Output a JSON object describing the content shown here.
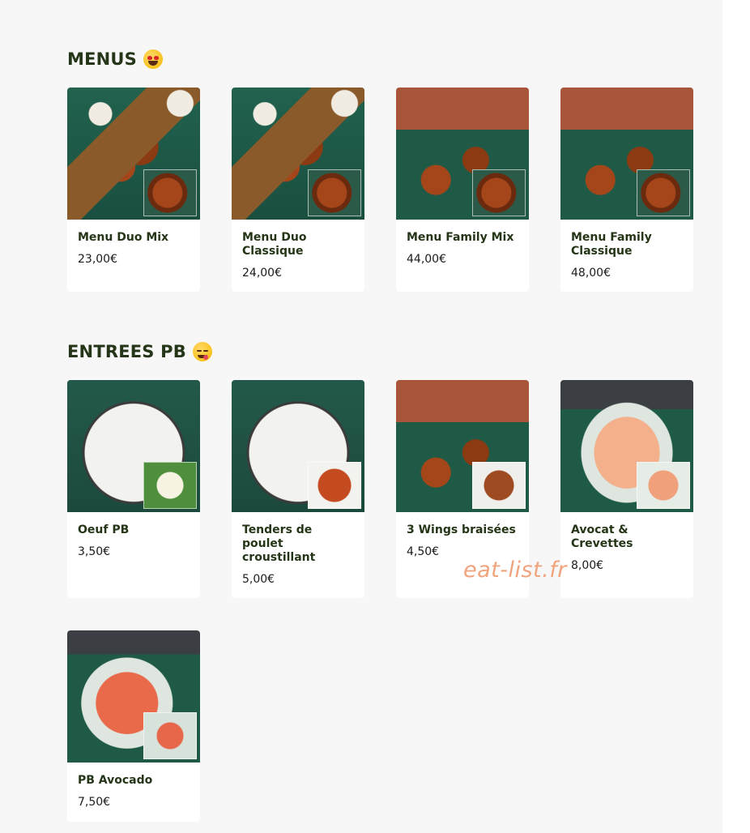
{
  "sections": [
    {
      "title": "MENUS",
      "emoji": "star-struck-emoji",
      "items": [
        {
          "name": "Menu Duo Mix",
          "price": "23,00€"
        },
        {
          "name": "Menu Duo Classique",
          "price": "24,00€"
        },
        {
          "name": "Menu Family Mix",
          "price": "44,00€"
        },
        {
          "name": "Menu Family Classique",
          "price": "48,00€"
        }
      ]
    },
    {
      "title": "ENTREES PB",
      "emoji": "yum-face-emoji",
      "items": [
        {
          "name": "Oeuf PB",
          "price": "3,50€"
        },
        {
          "name": "Tenders de poulet croustillant",
          "price": "5,00€"
        },
        {
          "name": "3 Wings braisées",
          "price": "4,50€"
        },
        {
          "name": "Avocat & Crevettes",
          "price": "8,00€"
        },
        {
          "name": "PB Avocado",
          "price": "7,50€"
        }
      ]
    }
  ],
  "watermark": "eat-list.fr"
}
